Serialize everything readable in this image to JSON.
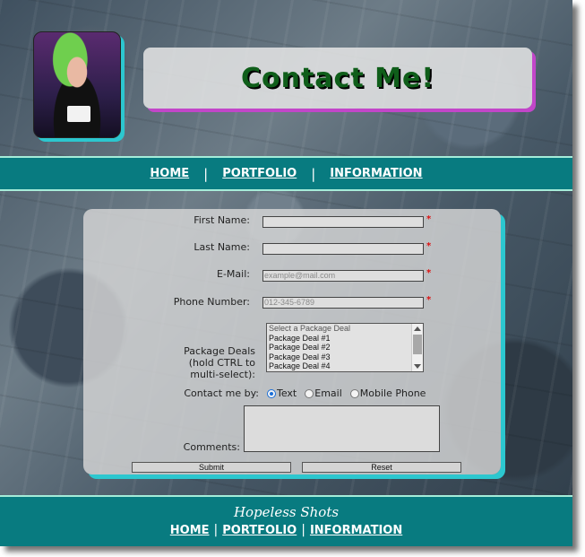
{
  "header": {
    "title": "Contact Me!"
  },
  "nav": {
    "items": [
      {
        "label": "HOME"
      },
      {
        "label": "PORTFOLIO"
      },
      {
        "label": "INFORMATION"
      }
    ],
    "separator": "|"
  },
  "form": {
    "first_name": {
      "label": "First Name:",
      "value": "",
      "placeholder": "",
      "required_mark": "*"
    },
    "last_name": {
      "label": "Last Name:",
      "value": "",
      "placeholder": "",
      "required_mark": "*"
    },
    "email": {
      "label": "E-Mail:",
      "value": "",
      "placeholder": "example@mail.com",
      "required_mark": "*"
    },
    "phone": {
      "label": "Phone Number:",
      "value": "",
      "placeholder": "012-345-6789",
      "required_mark": "*"
    },
    "packages": {
      "label_line1": "Package Deals",
      "label_line2": "(hold CTRL to",
      "label_line3": "multi-select):",
      "options": [
        "Select a Package Deal",
        "Package Deal #1",
        "Package Deal #2",
        "Package Deal #3",
        "Package Deal #4"
      ]
    },
    "contact_method": {
      "label": "Contact me by:",
      "options": [
        {
          "label": "Text",
          "checked": true
        },
        {
          "label": "Email",
          "checked": false
        },
        {
          "label": "Mobile Phone",
          "checked": false
        }
      ]
    },
    "comments": {
      "label": "Comments:",
      "value": ""
    },
    "submit_label": "Submit",
    "reset_label": "Reset"
  },
  "footer": {
    "brand": "Hopeless Shots",
    "links": [
      {
        "label": "HOME"
      },
      {
        "label": "PORTFOLIO"
      },
      {
        "label": "INFORMATION"
      }
    ],
    "separator": "|"
  },
  "colors": {
    "teal": "#087b80",
    "accent_cyan": "#2cc7cf",
    "accent_magenta": "#c246c9",
    "title_green": "#0f5e1a",
    "required_red": "#dd1111",
    "radio_blue": "#1a6fd8"
  }
}
